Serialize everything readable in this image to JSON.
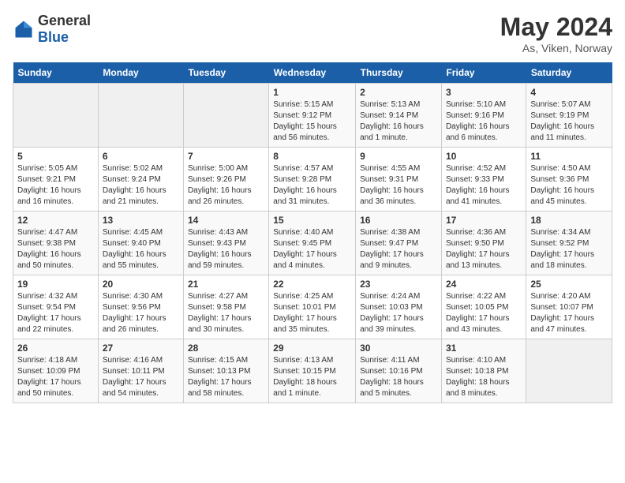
{
  "header": {
    "logo_general": "General",
    "logo_blue": "Blue",
    "title": "May 2024",
    "subtitle": "As, Viken, Norway"
  },
  "weekdays": [
    "Sunday",
    "Monday",
    "Tuesday",
    "Wednesday",
    "Thursday",
    "Friday",
    "Saturday"
  ],
  "weeks": [
    [
      {
        "day": "",
        "empty": true
      },
      {
        "day": "",
        "empty": true
      },
      {
        "day": "",
        "empty": true
      },
      {
        "day": "1",
        "sunrise": "5:15 AM",
        "sunset": "9:12 PM",
        "daylight": "15 hours and 56 minutes."
      },
      {
        "day": "2",
        "sunrise": "5:13 AM",
        "sunset": "9:14 PM",
        "daylight": "16 hours and 1 minute."
      },
      {
        "day": "3",
        "sunrise": "5:10 AM",
        "sunset": "9:16 PM",
        "daylight": "16 hours and 6 minutes."
      },
      {
        "day": "4",
        "sunrise": "5:07 AM",
        "sunset": "9:19 PM",
        "daylight": "16 hours and 11 minutes."
      }
    ],
    [
      {
        "day": "5",
        "sunrise": "5:05 AM",
        "sunset": "9:21 PM",
        "daylight": "16 hours and 16 minutes."
      },
      {
        "day": "6",
        "sunrise": "5:02 AM",
        "sunset": "9:24 PM",
        "daylight": "16 hours and 21 minutes."
      },
      {
        "day": "7",
        "sunrise": "5:00 AM",
        "sunset": "9:26 PM",
        "daylight": "16 hours and 26 minutes."
      },
      {
        "day": "8",
        "sunrise": "4:57 AM",
        "sunset": "9:28 PM",
        "daylight": "16 hours and 31 minutes."
      },
      {
        "day": "9",
        "sunrise": "4:55 AM",
        "sunset": "9:31 PM",
        "daylight": "16 hours and 36 minutes."
      },
      {
        "day": "10",
        "sunrise": "4:52 AM",
        "sunset": "9:33 PM",
        "daylight": "16 hours and 41 minutes."
      },
      {
        "day": "11",
        "sunrise": "4:50 AM",
        "sunset": "9:36 PM",
        "daylight": "16 hours and 45 minutes."
      }
    ],
    [
      {
        "day": "12",
        "sunrise": "4:47 AM",
        "sunset": "9:38 PM",
        "daylight": "16 hours and 50 minutes."
      },
      {
        "day": "13",
        "sunrise": "4:45 AM",
        "sunset": "9:40 PM",
        "daylight": "16 hours and 55 minutes."
      },
      {
        "day": "14",
        "sunrise": "4:43 AM",
        "sunset": "9:43 PM",
        "daylight": "16 hours and 59 minutes."
      },
      {
        "day": "15",
        "sunrise": "4:40 AM",
        "sunset": "9:45 PM",
        "daylight": "17 hours and 4 minutes."
      },
      {
        "day": "16",
        "sunrise": "4:38 AM",
        "sunset": "9:47 PM",
        "daylight": "17 hours and 9 minutes."
      },
      {
        "day": "17",
        "sunrise": "4:36 AM",
        "sunset": "9:50 PM",
        "daylight": "17 hours and 13 minutes."
      },
      {
        "day": "18",
        "sunrise": "4:34 AM",
        "sunset": "9:52 PM",
        "daylight": "17 hours and 18 minutes."
      }
    ],
    [
      {
        "day": "19",
        "sunrise": "4:32 AM",
        "sunset": "9:54 PM",
        "daylight": "17 hours and 22 minutes."
      },
      {
        "day": "20",
        "sunrise": "4:30 AM",
        "sunset": "9:56 PM",
        "daylight": "17 hours and 26 minutes."
      },
      {
        "day": "21",
        "sunrise": "4:27 AM",
        "sunset": "9:58 PM",
        "daylight": "17 hours and 30 minutes."
      },
      {
        "day": "22",
        "sunrise": "4:25 AM",
        "sunset": "10:01 PM",
        "daylight": "17 hours and 35 minutes."
      },
      {
        "day": "23",
        "sunrise": "4:24 AM",
        "sunset": "10:03 PM",
        "daylight": "17 hours and 39 minutes."
      },
      {
        "day": "24",
        "sunrise": "4:22 AM",
        "sunset": "10:05 PM",
        "daylight": "17 hours and 43 minutes."
      },
      {
        "day": "25",
        "sunrise": "4:20 AM",
        "sunset": "10:07 PM",
        "daylight": "17 hours and 47 minutes."
      }
    ],
    [
      {
        "day": "26",
        "sunrise": "4:18 AM",
        "sunset": "10:09 PM",
        "daylight": "17 hours and 50 minutes."
      },
      {
        "day": "27",
        "sunrise": "4:16 AM",
        "sunset": "10:11 PM",
        "daylight": "17 hours and 54 minutes."
      },
      {
        "day": "28",
        "sunrise": "4:15 AM",
        "sunset": "10:13 PM",
        "daylight": "17 hours and 58 minutes."
      },
      {
        "day": "29",
        "sunrise": "4:13 AM",
        "sunset": "10:15 PM",
        "daylight": "18 hours and 1 minute."
      },
      {
        "day": "30",
        "sunrise": "4:11 AM",
        "sunset": "10:16 PM",
        "daylight": "18 hours and 5 minutes."
      },
      {
        "day": "31",
        "sunrise": "4:10 AM",
        "sunset": "10:18 PM",
        "daylight": "18 hours and 8 minutes."
      },
      {
        "day": "",
        "empty": true
      }
    ]
  ],
  "labels": {
    "sunrise_prefix": "Sunrise: ",
    "sunset_prefix": "Sunset: ",
    "daylight_prefix": "Daylight: "
  }
}
